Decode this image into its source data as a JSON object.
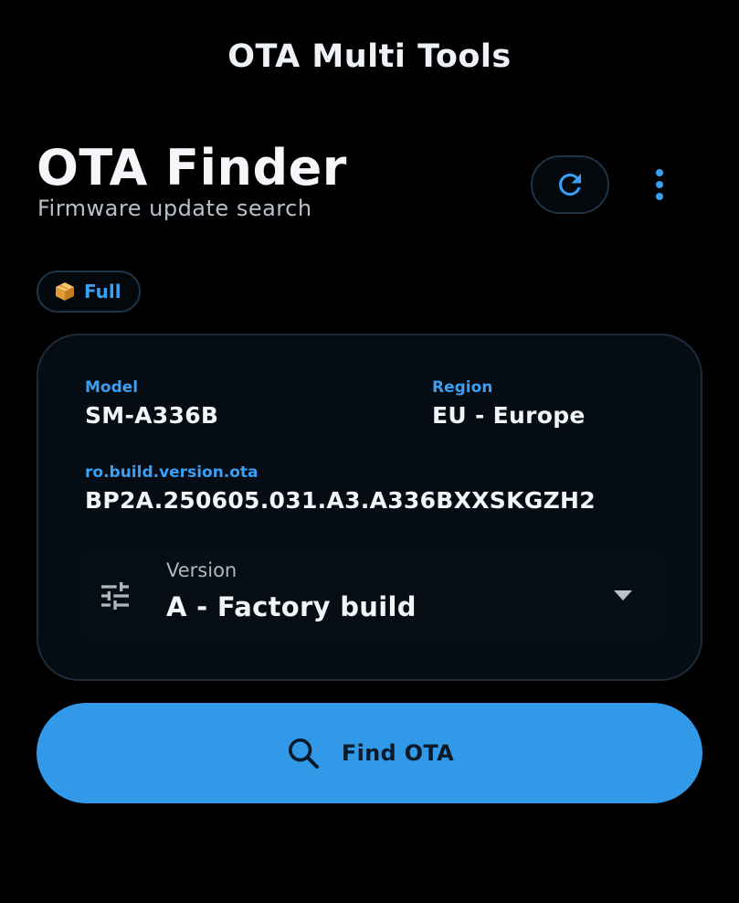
{
  "app": {
    "title": "OTA Multi Tools"
  },
  "header": {
    "title": "OTA Finder",
    "subtitle": "Firmware update search",
    "refresh_icon": "refresh-icon",
    "more_icon": "more-vert-icon"
  },
  "chip": {
    "icon": "package-icon",
    "label": "Full"
  },
  "form": {
    "model": {
      "label": "Model",
      "value": "SM-A336B"
    },
    "region": {
      "label": "Region",
      "value": "EU - Europe"
    },
    "ota": {
      "label": "ro.build.version.ota",
      "value": "BP2A.250605.031.A3.A336BXXSKGZH2"
    },
    "version": {
      "icon": "tune-icon",
      "label": "Version",
      "selected": "A - Factory build"
    }
  },
  "actions": {
    "find_label": "Find OTA",
    "find_icon": "search-icon"
  },
  "colors": {
    "accent": "#3aa0f5",
    "button_bg": "#3299e8",
    "background": "#000000",
    "card_bg": "#060c13",
    "border": "#1d2b3a"
  }
}
